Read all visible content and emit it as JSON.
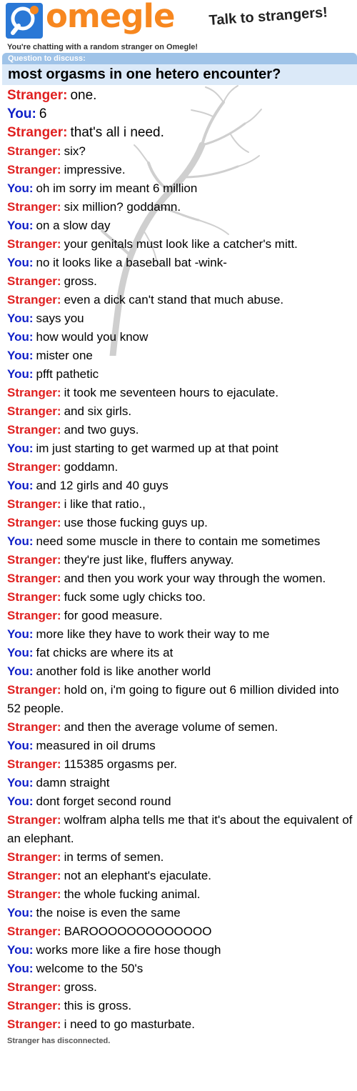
{
  "header": {
    "logo_text": "omegle",
    "tagline": "Talk to strangers!",
    "subtitle": "You're chatting with a random stranger on Omegle!"
  },
  "question": {
    "label": "Question to discuss:",
    "text": "most orgasms in one hetero encounter?"
  },
  "speakers": {
    "stranger": "Stranger:",
    "you": "You:"
  },
  "messages": [
    {
      "from": "stranger",
      "text": "one.",
      "big": true
    },
    {
      "from": "you",
      "text": "6",
      "big": true
    },
    {
      "from": "stranger",
      "text": "that's all i need.",
      "big": true
    },
    {
      "from": "stranger",
      "text": "six?"
    },
    {
      "from": "stranger",
      "text": "impressive."
    },
    {
      "from": "you",
      "text": "oh im sorry im meant 6 million"
    },
    {
      "from": "stranger",
      "text": "six million? goddamn."
    },
    {
      "from": "you",
      "text": "on a slow day"
    },
    {
      "from": "stranger",
      "text": "your genitals must look like a catcher's mitt."
    },
    {
      "from": "you",
      "text": "no it looks like a baseball bat -wink-"
    },
    {
      "from": "stranger",
      "text": "gross."
    },
    {
      "from": "stranger",
      "text": "even a dick can't stand that much abuse."
    },
    {
      "from": "you",
      "text": "says you"
    },
    {
      "from": "you",
      "text": "how would you know"
    },
    {
      "from": "you",
      "text": "mister one"
    },
    {
      "from": "you",
      "text": "pfft pathetic"
    },
    {
      "from": "stranger",
      "text": "it took me seventeen hours to ejaculate."
    },
    {
      "from": "stranger",
      "text": "and six girls."
    },
    {
      "from": "stranger",
      "text": "and two guys."
    },
    {
      "from": "you",
      "text": "im just starting to get warmed up at that point"
    },
    {
      "from": "stranger",
      "text": "goddamn."
    },
    {
      "from": "you",
      "text": "and 12 girls and 40 guys"
    },
    {
      "from": "stranger",
      "text": "i like that ratio.,"
    },
    {
      "from": "stranger",
      "text": "use those fucking guys up."
    },
    {
      "from": "you",
      "text": "need some muscle in there to contain me sometimes"
    },
    {
      "from": "stranger",
      "text": "they're just like, fluffers anyway."
    },
    {
      "from": "stranger",
      "text": "and then you work your way through the women."
    },
    {
      "from": "stranger",
      "text": "fuck some ugly chicks too."
    },
    {
      "from": "stranger",
      "text": "for good measure."
    },
    {
      "from": "you",
      "text": "more like they have to work their way to me"
    },
    {
      "from": "you",
      "text": "fat chicks are where its at"
    },
    {
      "from": "you",
      "text": "another fold is like another world"
    },
    {
      "from": "stranger",
      "text": "hold on, i'm going to figure out 6 million divided into 52 people."
    },
    {
      "from": "stranger",
      "text": "and then the average volume of semen."
    },
    {
      "from": "you",
      "text": "measured in oil drums"
    },
    {
      "from": "stranger",
      "text": "115385 orgasms per."
    },
    {
      "from": "you",
      "text": "damn straight"
    },
    {
      "from": "you",
      "text": "dont forget second round"
    },
    {
      "from": "stranger",
      "text": "wolfram alpha tells me that it's about the equivalent of an elephant."
    },
    {
      "from": "stranger",
      "text": "in terms of semen."
    },
    {
      "from": "stranger",
      "text": "not an elephant's ejaculate."
    },
    {
      "from": "stranger",
      "text": "the whole fucking animal."
    },
    {
      "from": "you",
      "text": "the noise is even the same"
    },
    {
      "from": "stranger",
      "text": "BAROOOOOOOOOOOOO"
    },
    {
      "from": "you",
      "text": "works more like a fire hose though"
    },
    {
      "from": "you",
      "text": "welcome to the 50's"
    },
    {
      "from": "stranger",
      "text": "gross."
    },
    {
      "from": "stranger",
      "text": "this is gross."
    },
    {
      "from": "stranger",
      "text": "i need to go masturbate."
    }
  ],
  "status": "Stranger has disconnected.",
  "colors": {
    "stranger": "#e02020",
    "you": "#1020c8",
    "brand_orange": "#f7871f",
    "brand_blue": "#2a78d6"
  },
  "icons": {
    "logo": "omegle-logo-icon",
    "background": "tree-watermark-icon"
  }
}
